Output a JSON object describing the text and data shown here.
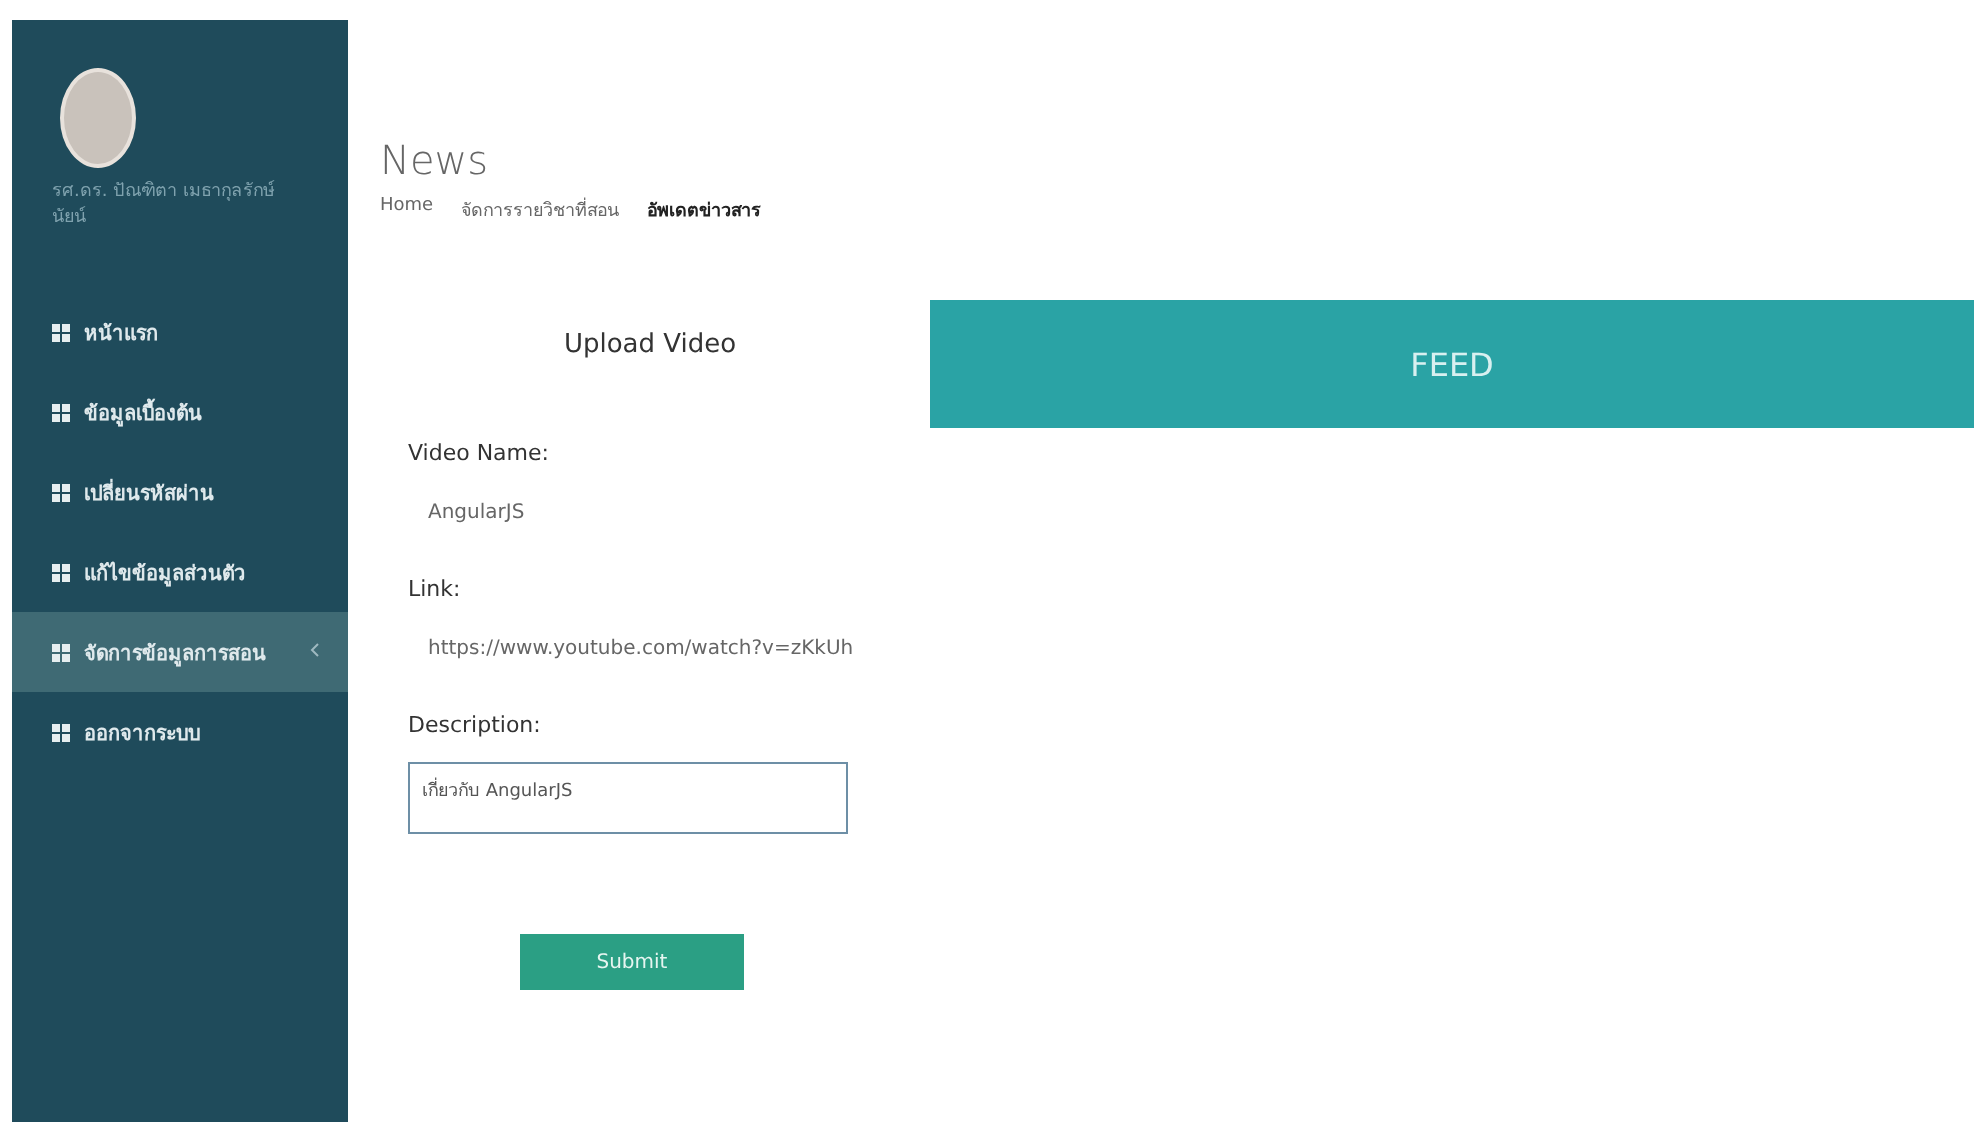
{
  "sidebar": {
    "user": {
      "name": "รศ.ดร. ปัณฑิตา เมธากุลรักษ์ นัยน์"
    },
    "items": [
      {
        "label": "หน้าแรก",
        "selected": false
      },
      {
        "label": "ข้อมูลเบื้องต้น",
        "selected": false
      },
      {
        "label": "เปลี่ยนรหัสผ่าน",
        "selected": false
      },
      {
        "label": "แก้ไขข้อมูลส่วนตัว",
        "selected": false
      },
      {
        "label": "จัดการข้อมูลการสอน",
        "selected": true,
        "expandable": true
      },
      {
        "label": "ออกจากระบบ",
        "selected": false
      }
    ]
  },
  "page": {
    "title": "News",
    "breadcrumb": [
      "Home",
      "จัดการรายวิชาที่สอน",
      "อัพเดตข่าวสาร"
    ]
  },
  "tabs": [
    {
      "label": "Upload Video",
      "selected": true
    },
    {
      "label": "FEED",
      "selected": false
    }
  ],
  "form": {
    "fields": [
      {
        "label": "Video Name:",
        "value": "AngularJS",
        "kind": "text"
      },
      {
        "label": "Link:",
        "value": "https://www.youtube.com/watch?v=zKkUh",
        "kind": "text"
      },
      {
        "label": "Description:",
        "value": "เกี่ยวกับ AngularJS",
        "kind": "textarea"
      }
    ],
    "submit": "Submit"
  }
}
